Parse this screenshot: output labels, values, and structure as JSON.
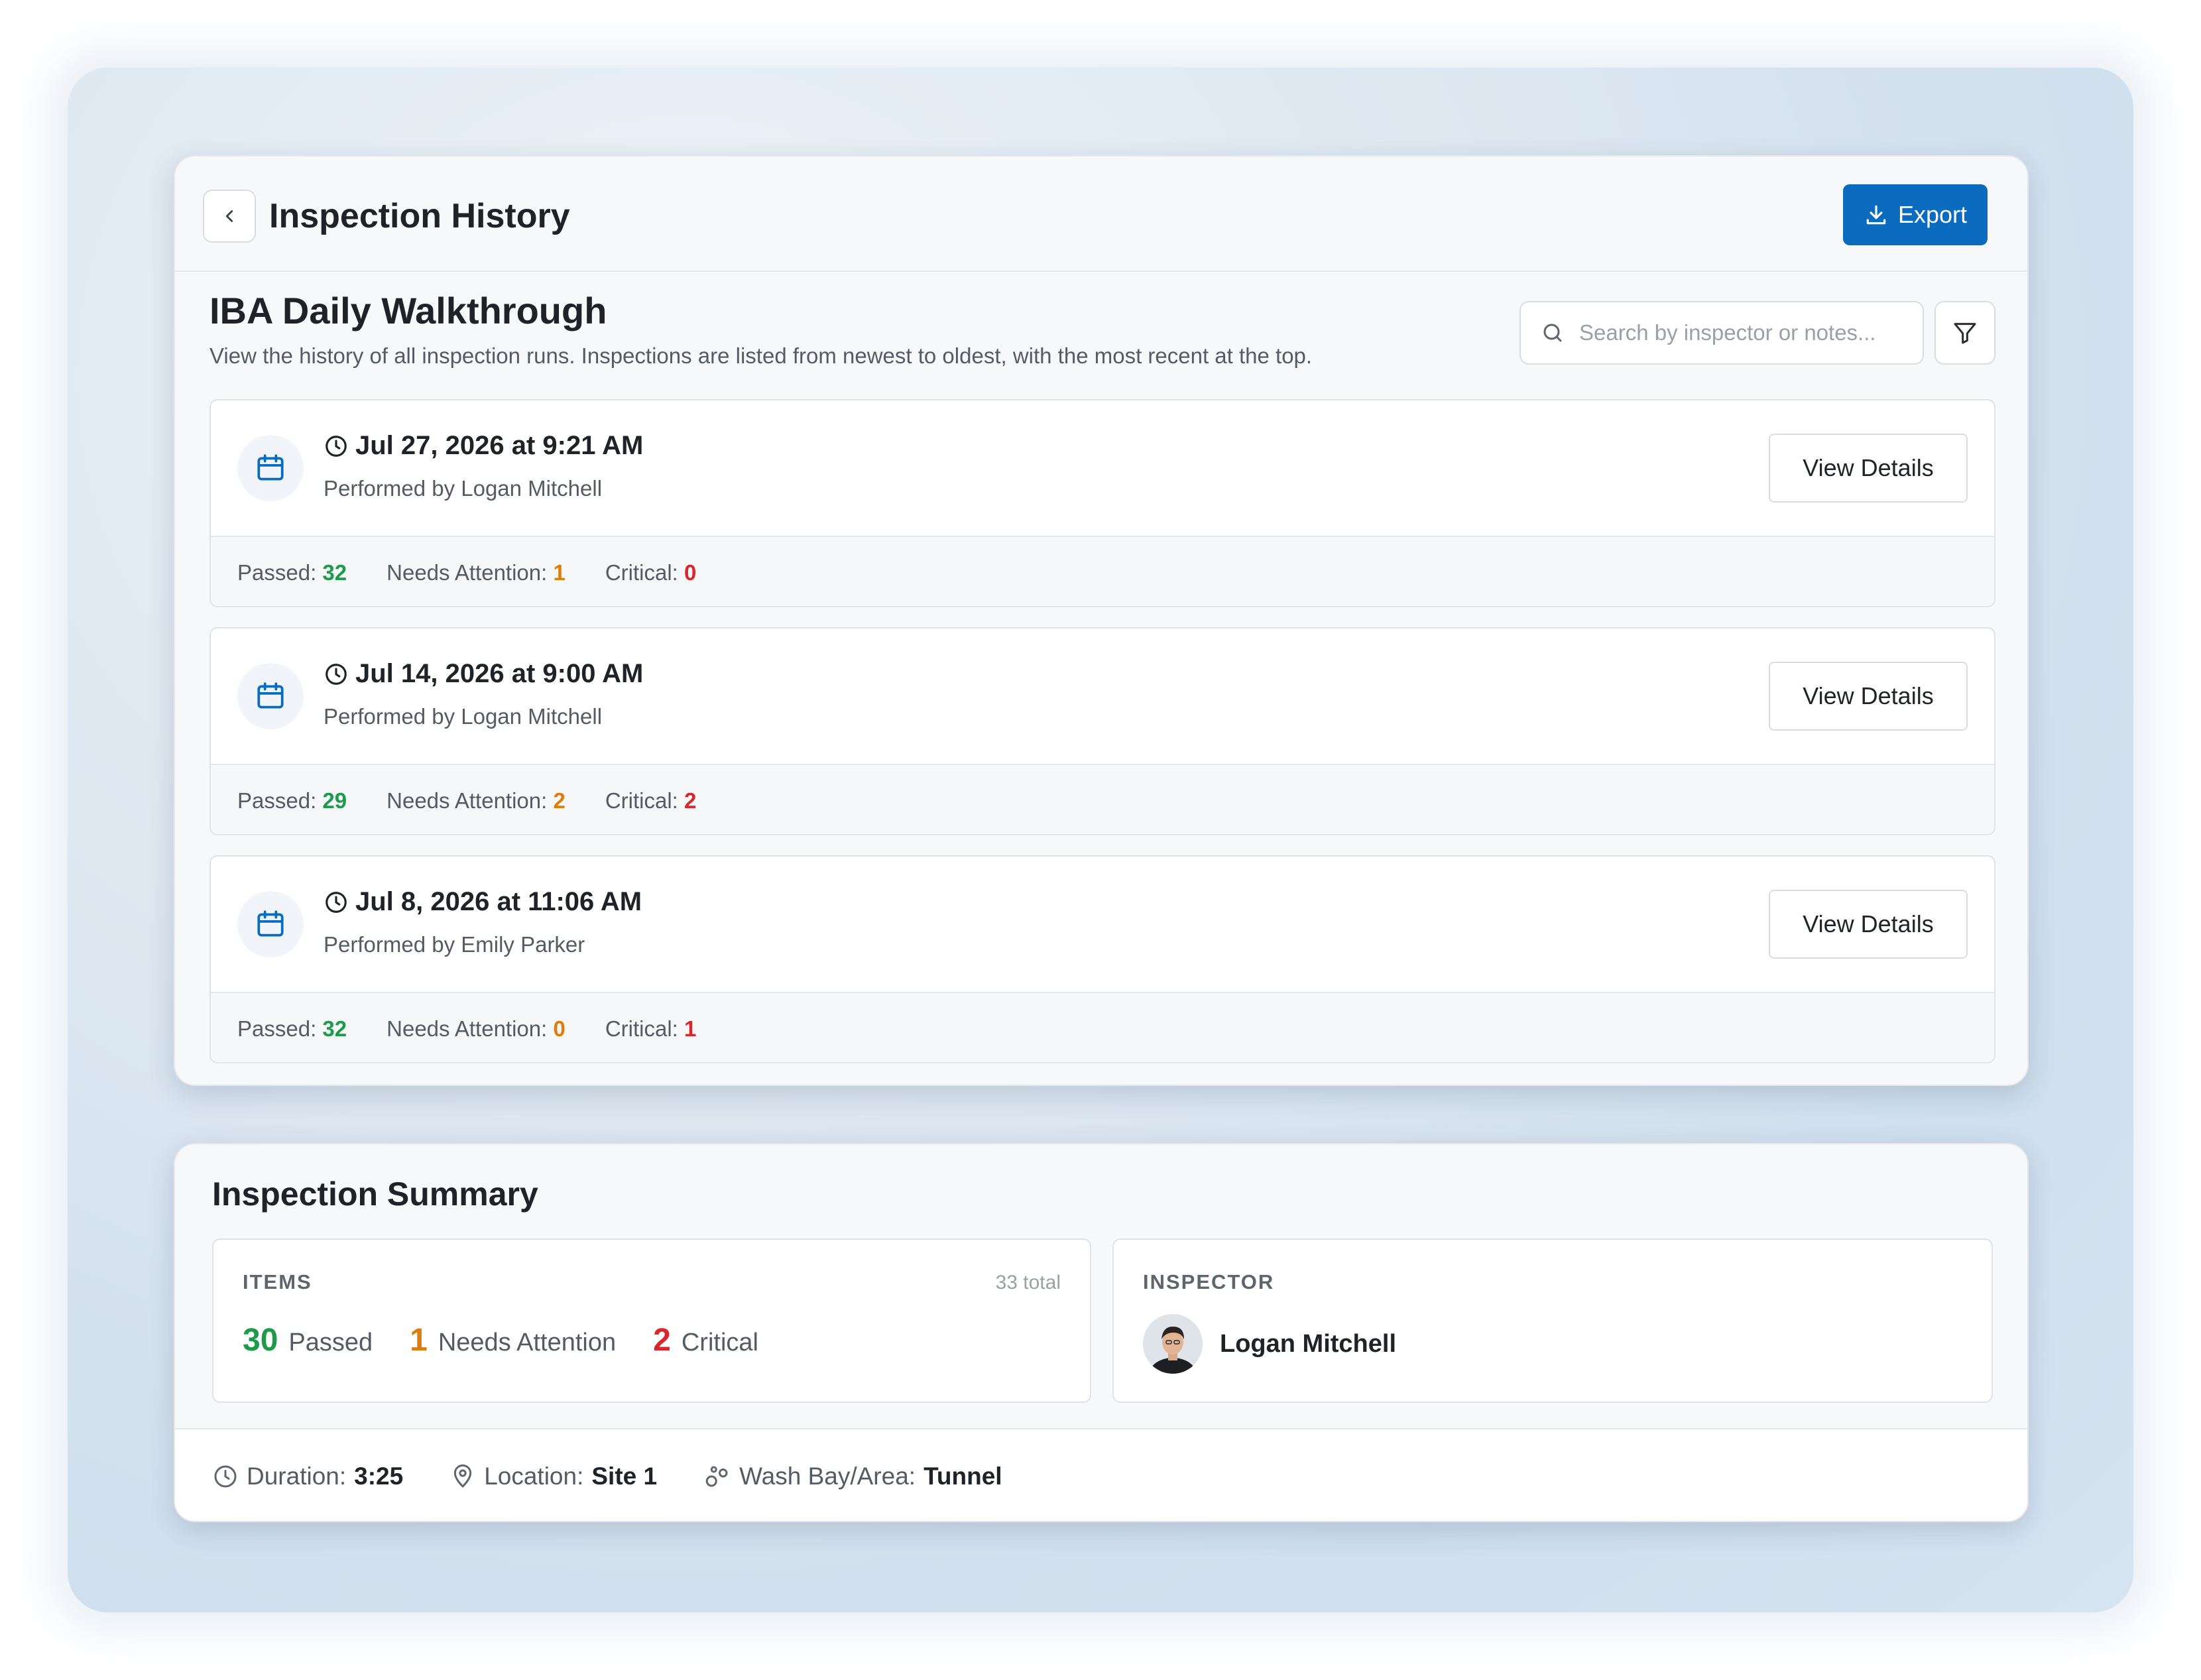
{
  "header": {
    "title": "Inspection History",
    "export_label": "Export"
  },
  "checklist": {
    "name": "IBA Daily Walkthrough",
    "description": "View the history of all inspection runs. Inspections are listed from newest to oldest, with the most recent at the top.",
    "search_placeholder": "Search by inspector or notes..."
  },
  "runs": [
    {
      "date": "Jul 27, 2026 at 9:21 AM",
      "performed_by": "Performed by Logan Mitchell",
      "view_label": "View Details",
      "passed_label": "Passed:",
      "passed": "32",
      "attention_label": "Needs Attention:",
      "attention": "1",
      "critical_label": "Critical:",
      "critical": "0"
    },
    {
      "date": "Jul 14, 2026 at 9:00 AM",
      "performed_by": "Performed by Logan Mitchell",
      "view_label": "View Details",
      "passed_label": "Passed:",
      "passed": "29",
      "attention_label": "Needs Attention:",
      "attention": "2",
      "critical_label": "Critical:",
      "critical": "2"
    },
    {
      "date": "Jul 8, 2026 at 11:06 AM",
      "performed_by": "Performed by Emily Parker",
      "view_label": "View Details",
      "passed_label": "Passed:",
      "passed": "32",
      "attention_label": "Needs Attention:",
      "attention": "0",
      "critical_label": "Critical:",
      "critical": "1"
    }
  ],
  "summary": {
    "title": "Inspection Summary",
    "items_label": "ITEMS",
    "items_total": "33 total",
    "passed_count": "30",
    "passed_label": "Passed",
    "attention_count": "1",
    "attention_label": "Needs Attention",
    "critical_count": "2",
    "critical_label": "Critical",
    "inspector_label": "INSPECTOR",
    "inspector_name": "Logan Mitchell",
    "duration_label": "Duration:",
    "duration": "3:25",
    "location_label": "Location:",
    "location": "Site 1",
    "area_label": "Wash Bay/Area:",
    "area": "Tunnel"
  },
  "colors": {
    "accent": "#0b6bbf",
    "passed": "#1e9a4a",
    "attention": "#dd7c0f",
    "critical": "#d7262c"
  },
  "icons": [
    "chevron-left-icon",
    "download-icon",
    "search-icon",
    "filter-icon",
    "calendar-icon",
    "clock-icon",
    "map-pin-icon",
    "area-icon"
  ]
}
